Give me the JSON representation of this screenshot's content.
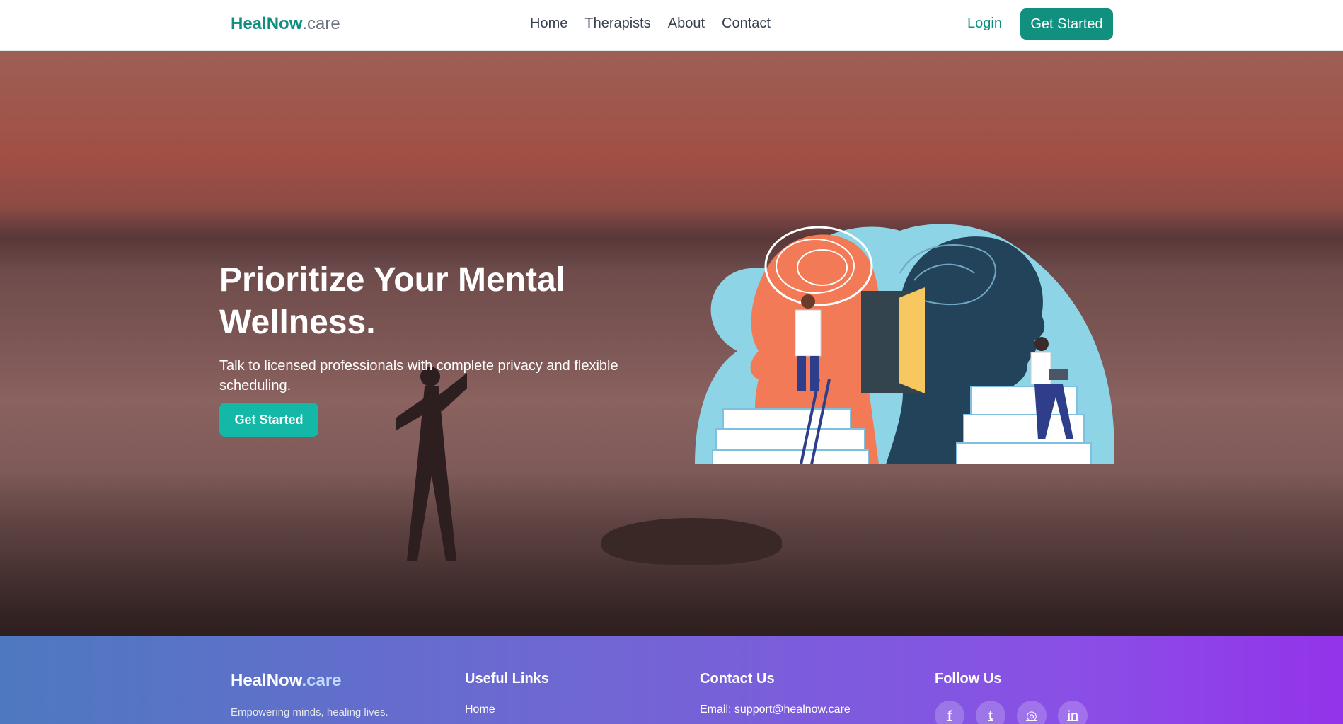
{
  "navbar": {
    "brand_main": "HealNow",
    "brand_suffix": ".care",
    "links": [
      "Home",
      "Therapists",
      "About",
      "Contact"
    ],
    "login": "Login",
    "cta": "Get Started"
  },
  "hero": {
    "title": "Prioritize Your Mental Wellness.",
    "subtitle": "Talk to licensed professionals with complete privacy and flexible scheduling.",
    "cta": "Get Started"
  },
  "footer": {
    "brand_main": "HealNow",
    "brand_suffix": ".care",
    "tagline": "Empowering minds, healing lives.",
    "useful_links_title": "Useful Links",
    "useful_links": [
      "Home"
    ],
    "contact_title": "Contact Us",
    "contact_email": "Email: support@healnow.care",
    "follow_title": "Follow Us",
    "social": [
      {
        "icon": "facebook-icon",
        "glyph": "f"
      },
      {
        "icon": "twitter-icon",
        "glyph": "t"
      },
      {
        "icon": "instagram-icon",
        "glyph": "◎"
      },
      {
        "icon": "linkedin-icon",
        "glyph": "in"
      }
    ]
  },
  "colors": {
    "brand": "#0f8f7f",
    "hero_cta": "#14b8a6",
    "footer_start": "#4e79c0",
    "footer_end": "#9333ea"
  }
}
